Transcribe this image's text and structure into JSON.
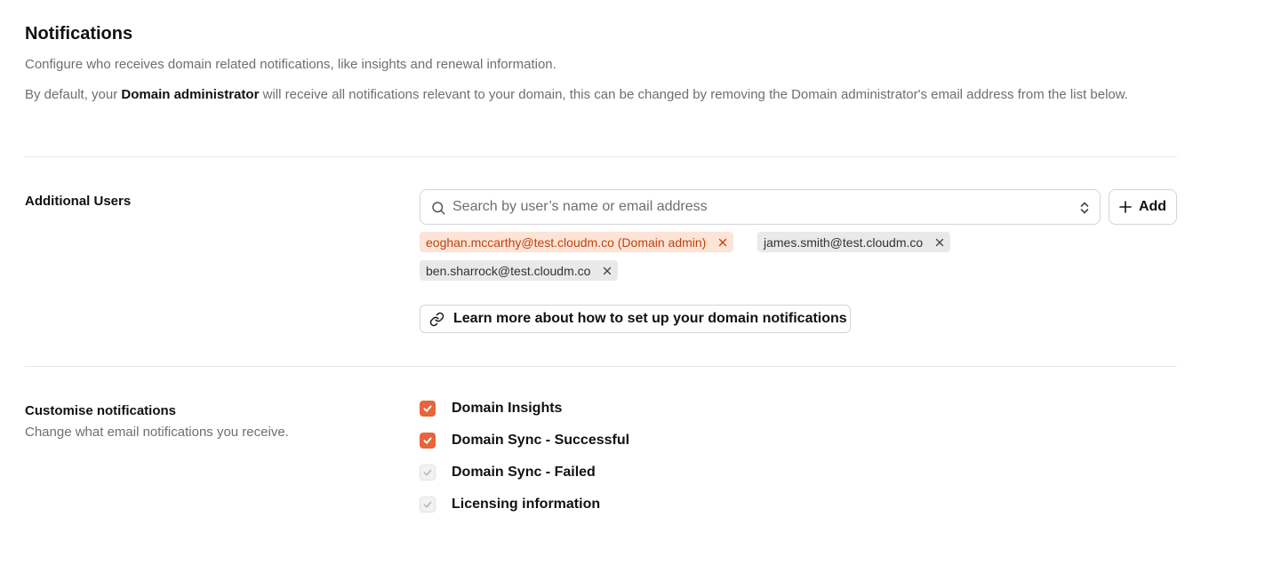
{
  "header": {
    "title": "Notifications",
    "description": "Configure who receives domain related notifications, like insights and renewal information.",
    "default_prefix": "By default, your ",
    "default_bold": "Domain administrator",
    "default_suffix": " will receive all notifications relevant to your domain, this can be changed by removing the Domain administrator's email address from the list below."
  },
  "additional_users": {
    "label": "Additional Users",
    "search_placeholder": "Search by user’s name or email address",
    "add_label": "Add",
    "chips": [
      {
        "text": "eoghan.mccarthy@test.cloudm.co (Domain admin)",
        "kind": "admin"
      },
      {
        "text": "james.smith@test.cloudm.co",
        "kind": "user"
      },
      {
        "text": "ben.sharrock@test.cloudm.co",
        "kind": "user"
      }
    ],
    "learn_more": "Learn more about how to set up your domain notifications"
  },
  "customise": {
    "label": "Customise notifications",
    "sublabel": "Change what email notifications you receive.",
    "options": [
      {
        "label": "Domain Insights",
        "checked": true
      },
      {
        "label": "Domain Sync - Successful",
        "checked": true
      },
      {
        "label": "Domain Sync - Failed",
        "checked": false
      },
      {
        "label": "Licensing information",
        "checked": false
      }
    ]
  },
  "colors": {
    "accent": "#e8643a",
    "admin_chip_bg": "#fde4d6",
    "admin_chip_text": "#c2410c",
    "user_chip_bg": "#e9e9eb",
    "muted_text": "#6b6f76"
  },
  "icons": {
    "search": "search-icon",
    "updown": "chevron-up-down-icon",
    "add": "plus-icon",
    "remove": "close-icon",
    "link": "link-icon",
    "check": "check-icon"
  }
}
